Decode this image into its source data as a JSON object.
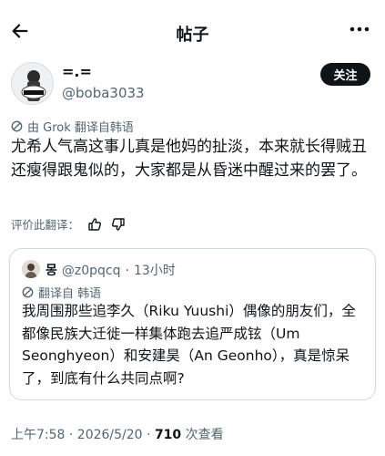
{
  "header": {
    "title": "帖子",
    "back_icon": "arrow-left-icon",
    "more_icon": "more-horizontal-icon"
  },
  "author": {
    "display_name": "=.=",
    "handle": "@boba3033",
    "follow_label": "关注"
  },
  "post": {
    "translation_note": "由 Grok 翻译自韩语",
    "text": "尤希人气高这事儿真是他妈的扯淡，本来就长得贼丑还瘦得跟鬼似的，大家都是从昏迷中醒过来的罢了。",
    "rate_translation_label": "评价此翻译："
  },
  "quote": {
    "name": "몽",
    "handle": "@z0pqcq",
    "separator": "·",
    "time": "13小时",
    "translation_note": "翻译自 韩语",
    "text": "我周围那些追李久（Riku Yuushi）偶像的朋友们，全都像民族大迁徙一样集体跑去追严成铉（Um Seonghyeon）和安建昊（An Geonho），真是惊呆了，到底有什么共同点啊?"
  },
  "footer": {
    "timestamp": "上午7:58 · 2026/5/20 · ",
    "views_count": "710",
    "views_label": " 次查看"
  }
}
